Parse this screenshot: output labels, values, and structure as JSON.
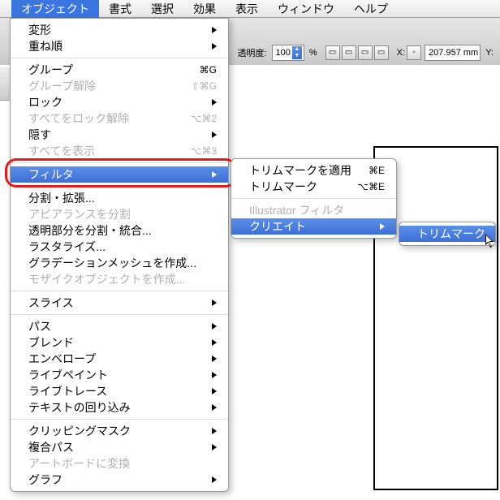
{
  "menubar": {
    "items": [
      "オブジェクト",
      "書式",
      "選択",
      "効果",
      "表示",
      "ウィンドウ",
      "ヘルプ"
    ],
    "active_index": 0
  },
  "toolbar": {
    "opacity_label": "透明度:",
    "opacity_value": "100",
    "opacity_unit": "%",
    "x_label": "X:",
    "x_value": "207.957 mm",
    "y_label": "Y:"
  },
  "menu_object": {
    "filter_highlighted": true,
    "items": [
      {
        "label": "変形",
        "sub": true
      },
      {
        "label": "重ね順",
        "sub": true
      },
      {
        "sep": true
      },
      {
        "label": "グループ",
        "shortcut": "⌘G"
      },
      {
        "label": "グループ解除",
        "shortcut": "⇧⌘G",
        "disabled": true
      },
      {
        "label": "ロック",
        "sub": true
      },
      {
        "label": "すべてをロック解除",
        "shortcut": "⌥⌘2",
        "disabled": true
      },
      {
        "label": "隠す",
        "sub": true
      },
      {
        "label": "すべてを表示",
        "shortcut": "⌥⌘3",
        "disabled": true
      },
      {
        "sep": true
      },
      {
        "label": "フィルタ",
        "sub": true,
        "hl": true
      },
      {
        "sep": true
      },
      {
        "label": "分割・拡張..."
      },
      {
        "label": "アピアランスを分割",
        "disabled": true
      },
      {
        "label": "透明部分を分割・統合..."
      },
      {
        "label": "ラスタライズ..."
      },
      {
        "label": "グラデーションメッシュを作成..."
      },
      {
        "label": "モザイクオブジェクトを作成...",
        "disabled": true
      },
      {
        "sep": true
      },
      {
        "label": "スライス",
        "sub": true
      },
      {
        "sep": true
      },
      {
        "label": "パス",
        "sub": true
      },
      {
        "label": "ブレンド",
        "sub": true
      },
      {
        "label": "エンベロープ",
        "sub": true
      },
      {
        "label": "ライブペイント",
        "sub": true
      },
      {
        "label": "ライブトレース",
        "sub": true
      },
      {
        "label": "テキストの回り込み",
        "sub": true
      },
      {
        "sep": true
      },
      {
        "label": "クリッピングマスク",
        "sub": true
      },
      {
        "label": "複合パス",
        "sub": true
      },
      {
        "label": "アートボードに変換",
        "disabled": true
      },
      {
        "label": "グラフ",
        "sub": true
      }
    ]
  },
  "menu_filter": {
    "items": [
      {
        "label": "トリムマークを適用",
        "shortcut": "⌘E"
      },
      {
        "label": "トリムマーク",
        "shortcut": "⌥⌘E"
      },
      {
        "sep": true
      },
      {
        "label": "Illustrator フィルタ",
        "disabled": true
      },
      {
        "label": "クリエイト",
        "sub": true,
        "hl": true
      }
    ]
  },
  "menu_create": {
    "items": [
      {
        "label": "トリムマーク",
        "hl": true
      }
    ]
  }
}
